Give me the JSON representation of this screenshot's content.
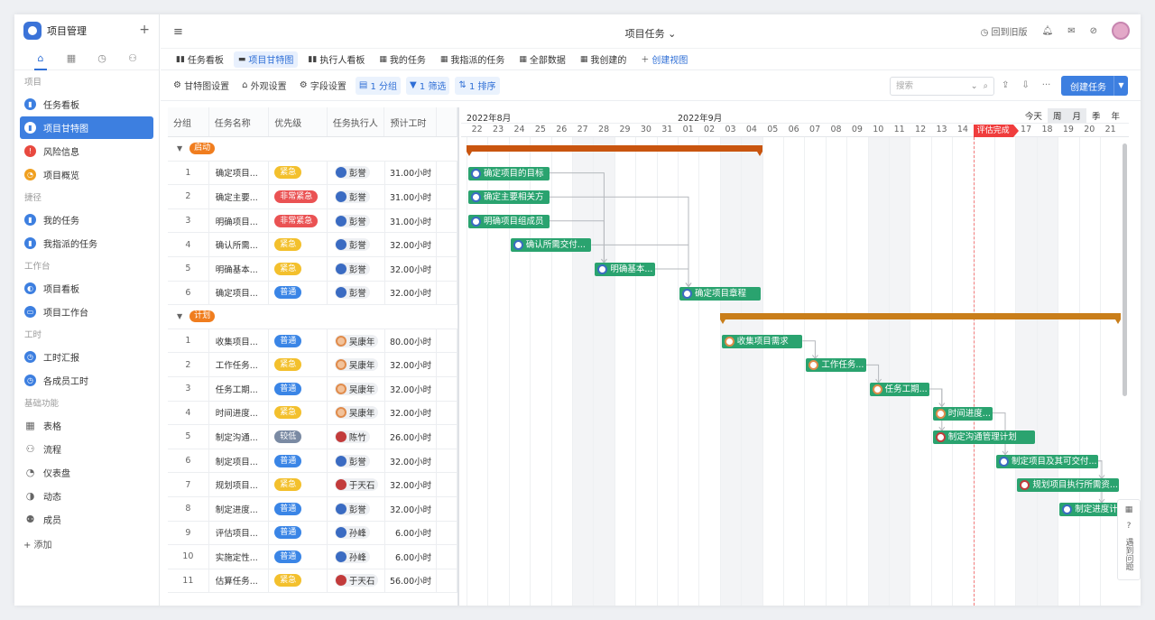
{
  "app": {
    "title": "项目管理"
  },
  "sidebar": {
    "sections": [
      {
        "label": "项目",
        "items": [
          {
            "label": "任务看板",
            "icon": "doc-icon",
            "color": "#3d7fe0"
          },
          {
            "label": "项目甘特图",
            "icon": "doc-icon",
            "color": "#3d7fe0",
            "active": true
          },
          {
            "label": "风险信息",
            "icon": "warning-icon",
            "color": "#e8493f"
          },
          {
            "label": "项目概览",
            "icon": "overview-icon",
            "color": "#f0a020"
          }
        ]
      },
      {
        "label": "捷径",
        "items": [
          {
            "label": "我的任务",
            "icon": "doc-icon"
          },
          {
            "label": "我指派的任务",
            "icon": "doc-icon"
          }
        ]
      },
      {
        "label": "工作台",
        "items": [
          {
            "label": "项目看板",
            "icon": "board-icon"
          },
          {
            "label": "项目工作台",
            "icon": "workbench-icon"
          }
        ]
      },
      {
        "label": "工时",
        "items": [
          {
            "label": "工时汇报",
            "icon": "clock-icon"
          },
          {
            "label": "各成员工时",
            "icon": "clock-icon"
          }
        ]
      },
      {
        "label": "基础功能",
        "items": [
          {
            "label": "表格",
            "icon": "table-icon"
          },
          {
            "label": "流程",
            "icon": "flow-icon"
          },
          {
            "label": "仪表盘",
            "icon": "dashboard-icon"
          },
          {
            "label": "动态",
            "icon": "activity-icon"
          },
          {
            "label": "成员",
            "icon": "members-icon"
          }
        ]
      }
    ],
    "add_label": "+ 添加"
  },
  "topbar": {
    "title": "项目任务 ⌄",
    "back_label": "回到旧版"
  },
  "viewtabs": [
    {
      "label": "任务看板",
      "icon": "board-icon"
    },
    {
      "label": "项目甘特图",
      "icon": "gantt-icon",
      "active": true
    },
    {
      "label": "执行人看板",
      "icon": "board-icon"
    },
    {
      "label": "我的任务",
      "icon": "table-icon"
    },
    {
      "label": "我指派的任务",
      "icon": "table-icon"
    },
    {
      "label": "全部数据",
      "icon": "grid-icon"
    },
    {
      "label": "我创建的",
      "icon": "table-icon"
    },
    {
      "label": "创建视图",
      "icon": "plus-icon",
      "blue": true
    }
  ],
  "toolbar": {
    "gantt_settings": "甘特图设置",
    "appearance": "外观设置",
    "fields": "字段设置",
    "group": "1 分组",
    "filter": "1 筛选",
    "sort": "1 排序",
    "search_placeholder": "搜索",
    "create_task": "创建任务"
  },
  "grid": {
    "headers": [
      "分组",
      "任务名称",
      "优先级",
      "任务执行人",
      "预计工时"
    ],
    "groups": [
      {
        "name": "启动",
        "rows": [
          {
            "n": "1",
            "name": "确定项目...",
            "pri": "紧急",
            "pc": "urgent",
            "person": "彭誉",
            "av": "b",
            "hours": "31.00小时"
          },
          {
            "n": "2",
            "name": "确定主要...",
            "pri": "非常紧急",
            "pc": "veryurgent",
            "person": "彭誉",
            "av": "b",
            "hours": "31.00小时"
          },
          {
            "n": "3",
            "name": "明确项目...",
            "pri": "非常紧急",
            "pc": "veryurgent",
            "person": "彭誉",
            "av": "b",
            "hours": "31.00小时"
          },
          {
            "n": "4",
            "name": "确认所需...",
            "pri": "紧急",
            "pc": "urgent",
            "person": "彭誉",
            "av": "b",
            "hours": "32.00小时"
          },
          {
            "n": "5",
            "name": "明确基本...",
            "pri": "紧急",
            "pc": "urgent",
            "person": "彭誉",
            "av": "b",
            "hours": "32.00小时"
          },
          {
            "n": "6",
            "name": "确定项目...",
            "pri": "普通",
            "pc": "normal",
            "person": "彭誉",
            "av": "b",
            "hours": "32.00小时"
          }
        ]
      },
      {
        "name": "计划",
        "rows": [
          {
            "n": "1",
            "name": "收集项目...",
            "pri": "普通",
            "pc": "normal",
            "person": "吴康年",
            "av": "o",
            "hours": "80.00小时"
          },
          {
            "n": "2",
            "name": "工作任务...",
            "pri": "紧急",
            "pc": "urgent",
            "person": "吴康年",
            "av": "o",
            "hours": "32.00小时"
          },
          {
            "n": "3",
            "name": "任务工期...",
            "pri": "普通",
            "pc": "normal",
            "person": "吴康年",
            "av": "o",
            "hours": "32.00小时"
          },
          {
            "n": "4",
            "name": "时间进度...",
            "pri": "紧急",
            "pc": "urgent",
            "person": "吴康年",
            "av": "o",
            "hours": "32.00小时"
          },
          {
            "n": "5",
            "name": "制定沟通...",
            "pri": "较低",
            "pc": "low",
            "person": "陈竹",
            "av": "r",
            "hours": "26.00小时"
          },
          {
            "n": "6",
            "name": "制定项目...",
            "pri": "普通",
            "pc": "normal",
            "person": "彭誉",
            "av": "b",
            "hours": "32.00小时"
          },
          {
            "n": "7",
            "name": "规划项目...",
            "pri": "紧急",
            "pc": "urgent",
            "person": "于天石",
            "av": "r",
            "hours": "32.00小时"
          },
          {
            "n": "8",
            "name": "制定进度...",
            "pri": "普通",
            "pc": "normal",
            "person": "彭誉",
            "av": "b",
            "hours": "32.00小时"
          },
          {
            "n": "9",
            "name": "评估项目...",
            "pri": "普通",
            "pc": "normal",
            "person": "孙峰",
            "av": "b",
            "hours": "6.00小时"
          },
          {
            "n": "10",
            "name": "实施定性...",
            "pri": "普通",
            "pc": "normal",
            "person": "孙峰",
            "av": "b",
            "hours": "6.00小时"
          },
          {
            "n": "11",
            "name": "估算任务...",
            "pri": "紧急",
            "pc": "urgent",
            "person": "于天石",
            "av": "r",
            "hours": "56.00小时"
          }
        ]
      }
    ]
  },
  "gantt": {
    "months": [
      {
        "label": "2022年8月",
        "start": 0
      },
      {
        "label": "2022年9月",
        "start": 10
      }
    ],
    "days": [
      "22",
      "23",
      "24",
      "25",
      "26",
      "27",
      "28",
      "29",
      "30",
      "31",
      "01",
      "02",
      "03",
      "04",
      "05",
      "06",
      "07",
      "08",
      "09",
      "10",
      "11",
      "12",
      "13",
      "14",
      "15",
      "16",
      "17",
      "18",
      "19",
      "20",
      "21"
    ],
    "today_index": 24,
    "today_flag": "评估完成",
    "scale": [
      "今天",
      "周",
      "月",
      "季",
      "年"
    ],
    "scale_active": [
      "周",
      "月"
    ],
    "summaries": [
      {
        "group": "启动",
        "start": 0,
        "end": 14,
        "row": 1,
        "color": "#c9550f"
      },
      {
        "group": "计划",
        "start": 12,
        "end": 31,
        "row": 8,
        "color": "#c97e1a"
      }
    ],
    "bars": [
      {
        "label": "确定项目的目标",
        "start": 0,
        "end": 4,
        "row": 2,
        "av": "b"
      },
      {
        "label": "确定主要相关方",
        "start": 0,
        "end": 4,
        "row": 3,
        "av": "b"
      },
      {
        "label": "明确项目组成员",
        "start": 0,
        "end": 4,
        "row": 4,
        "av": "b"
      },
      {
        "label": "确认所需交付...",
        "start": 2,
        "end": 6,
        "row": 5,
        "av": "b"
      },
      {
        "label": "明确基本...",
        "start": 6,
        "end": 9,
        "row": 6,
        "av": "b"
      },
      {
        "label": "确定项目章程",
        "start": 10,
        "end": 14,
        "row": 7,
        "av": "b"
      },
      {
        "label": "收集项目需求",
        "start": 12,
        "end": 16,
        "row": 9,
        "av": "o"
      },
      {
        "label": "工作任务...",
        "start": 16,
        "end": 19,
        "row": 10,
        "av": "o"
      },
      {
        "label": "任务工期...",
        "start": 19,
        "end": 22,
        "row": 11,
        "av": "o"
      },
      {
        "label": "时间进度...",
        "start": 22,
        "end": 25,
        "row": 12,
        "av": "o"
      },
      {
        "label": "制定沟通管理计划",
        "start": 22,
        "end": 27,
        "row": 13,
        "av": "r"
      },
      {
        "label": "制定项目及其可交付...",
        "start": 25,
        "end": 30,
        "row": 14,
        "av": "b"
      },
      {
        "label": "规划项目执行所需资...",
        "start": 26,
        "end": 31,
        "row": 15,
        "av": "r"
      },
      {
        "label": "制定进度计...",
        "start": 28,
        "end": 32,
        "row": 16,
        "av": "b"
      }
    ],
    "links": [
      [
        0,
        4
      ],
      [
        1,
        5
      ],
      [
        2,
        4
      ],
      [
        3,
        5
      ],
      [
        4,
        5
      ],
      [
        6,
        7
      ],
      [
        7,
        8
      ],
      [
        8,
        9
      ],
      [
        8,
        10
      ],
      [
        9,
        11
      ],
      [
        11,
        12
      ],
      [
        11,
        13
      ]
    ]
  },
  "float": {
    "qr_label": "QR",
    "help_label": "遇到问题"
  }
}
